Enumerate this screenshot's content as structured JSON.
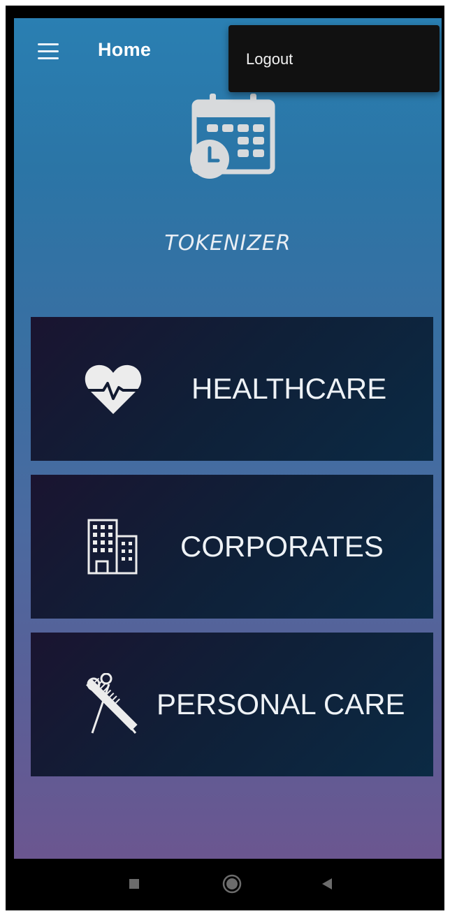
{
  "appbar": {
    "title": "Home",
    "menu_icon": "hamburger-menu-icon"
  },
  "overflow_menu": {
    "items": [
      {
        "label": "Logout"
      }
    ]
  },
  "brand": {
    "logo_icon": "calendar-clock-icon",
    "name": "TOKENIZER"
  },
  "categories": [
    {
      "label": "HEALTHCARE",
      "icon": "heart-pulse-icon"
    },
    {
      "label": "CORPORATES",
      "icon": "office-building-icon"
    },
    {
      "label": "PERSONAL CARE",
      "icon": "scissors-comb-icon"
    }
  ],
  "system_nav": {
    "buttons": [
      "recents-square-icon",
      "home-circle-icon",
      "back-triangle-icon"
    ]
  },
  "colors": {
    "gradient_top": "#2a7fb2",
    "gradient_bottom": "#6b5690",
    "card_bg": "#0f2038",
    "popup_bg": "#111111"
  }
}
